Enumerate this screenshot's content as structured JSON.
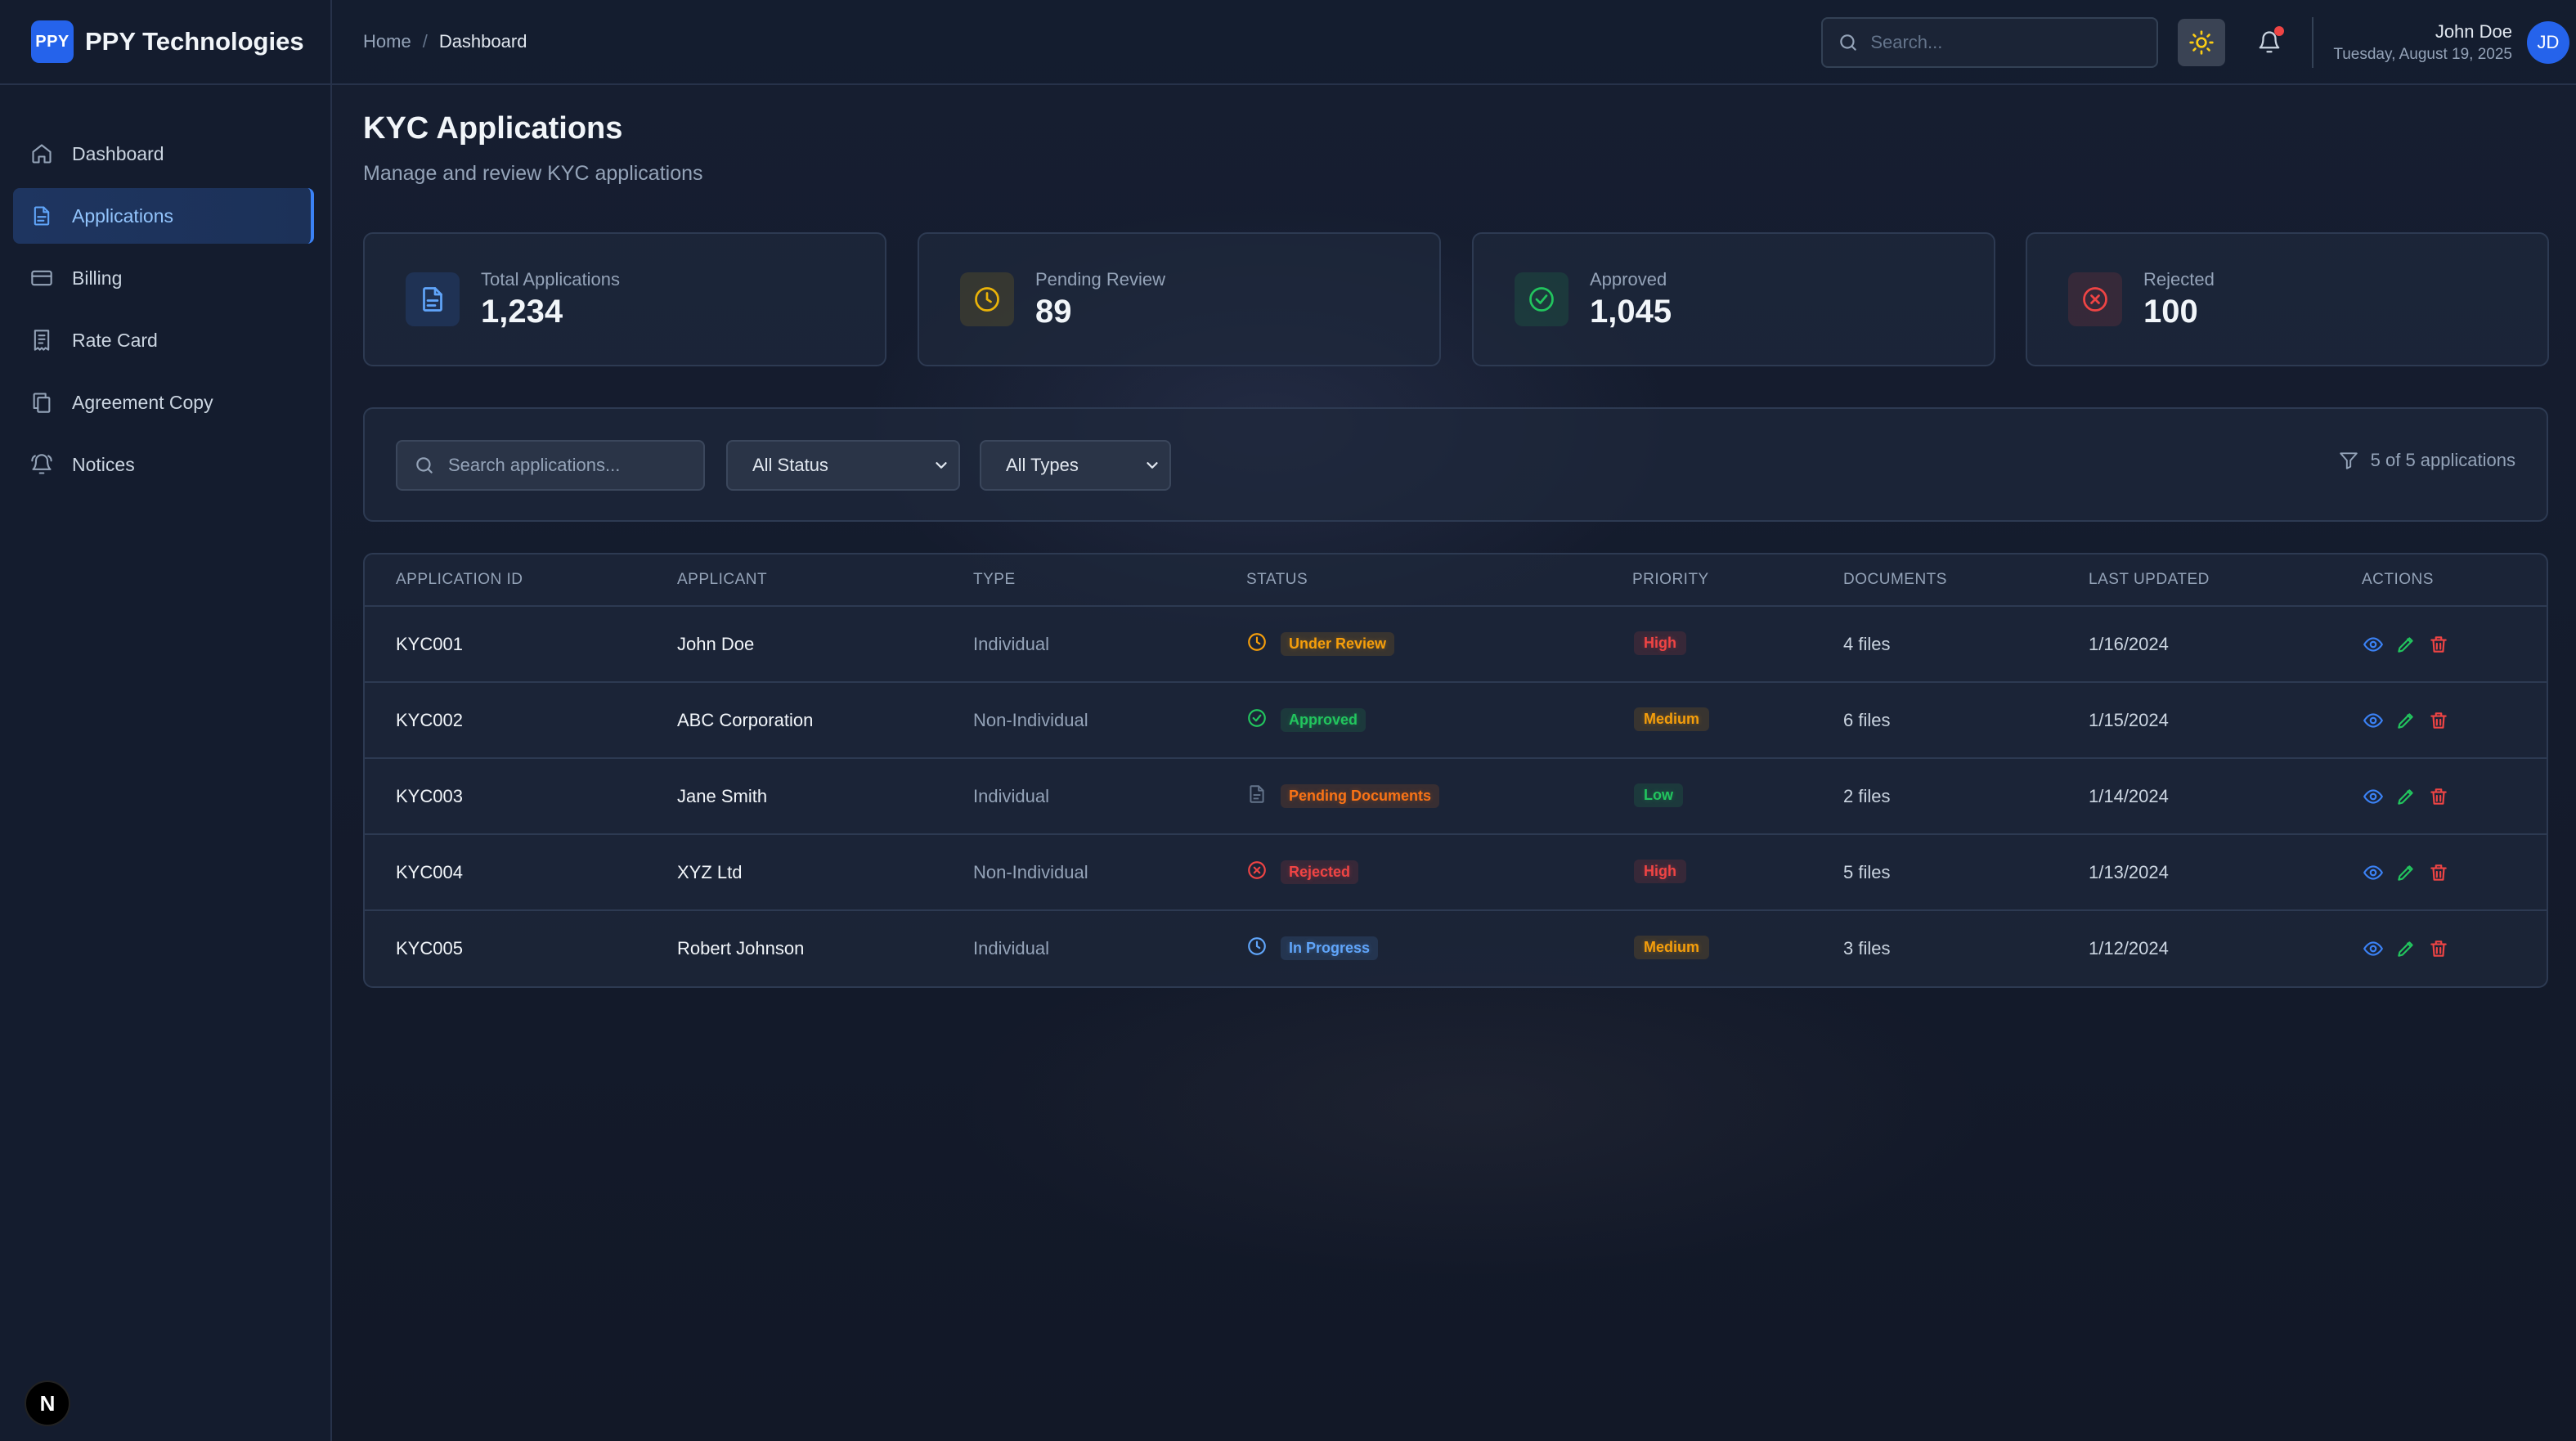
{
  "brand": {
    "logo_text": "PPY",
    "name": "PPY Technologies"
  },
  "sidebar": {
    "items": [
      {
        "label": "Dashboard",
        "icon": "home-icon",
        "active": false
      },
      {
        "label": "Applications",
        "icon": "document-icon",
        "active": true
      },
      {
        "label": "Billing",
        "icon": "credit-card-icon",
        "active": false
      },
      {
        "label": "Rate Card",
        "icon": "receipt-icon",
        "active": false
      },
      {
        "label": "Agreement Copy",
        "icon": "copy-icon",
        "active": false
      },
      {
        "label": "Notices",
        "icon": "bell-ring-icon",
        "active": false
      }
    ],
    "footer_badge": "N"
  },
  "header": {
    "breadcrumb": {
      "home": "Home",
      "separator": "/",
      "current": "Dashboard"
    },
    "search_placeholder": "Search...",
    "user": {
      "name": "John Doe",
      "date": "Tuesday, August 19, 2025",
      "initials": "JD"
    }
  },
  "page": {
    "title": "KYC Applications",
    "subtitle": "Manage and review KYC applications"
  },
  "stats": [
    {
      "label": "Total Applications",
      "value": "1,234",
      "icon": "file-text-icon",
      "color": "#60a5fa"
    },
    {
      "label": "Pending Review",
      "value": "89",
      "icon": "clock-icon",
      "color": "#eab308"
    },
    {
      "label": "Approved",
      "value": "1,045",
      "icon": "check-circle-icon",
      "color": "#22c55e"
    },
    {
      "label": "Rejected",
      "value": "100",
      "icon": "x-circle-icon",
      "color": "#ef4444"
    }
  ],
  "filters": {
    "search_placeholder": "Search applications...",
    "status_selected": "All Status",
    "type_selected": "All Types",
    "count_text": "5 of 5 applications"
  },
  "table": {
    "columns": [
      "APPLICATION ID",
      "APPLICANT",
      "TYPE",
      "STATUS",
      "PRIORITY",
      "DOCUMENTS",
      "LAST UPDATED",
      "ACTIONS"
    ],
    "rows": [
      {
        "id": "KYC001",
        "applicant": "John Doe",
        "type": "Individual",
        "status": "Under Review",
        "status_icon": "clock-icon",
        "priority": "High",
        "documents": "4 files",
        "updated": "1/16/2024"
      },
      {
        "id": "KYC002",
        "applicant": "ABC Corporation",
        "type": "Non-Individual",
        "status": "Approved",
        "status_icon": "check-circle-icon",
        "priority": "Medium",
        "documents": "6 files",
        "updated": "1/15/2024"
      },
      {
        "id": "KYC003",
        "applicant": "Jane Smith",
        "type": "Individual",
        "status": "Pending Documents",
        "status_icon": "file-icon",
        "priority": "Low",
        "documents": "2 files",
        "updated": "1/14/2024"
      },
      {
        "id": "KYC004",
        "applicant": "XYZ Ltd",
        "type": "Non-Individual",
        "status": "Rejected",
        "status_icon": "x-circle-icon",
        "priority": "High",
        "documents": "5 files",
        "updated": "1/13/2024"
      },
      {
        "id": "KYC005",
        "applicant": "Robert Johnson",
        "type": "Individual",
        "status": "In Progress",
        "status_icon": "clock-icon",
        "priority": "Medium",
        "documents": "3 files",
        "updated": "1/12/2024"
      }
    ]
  },
  "colors": {
    "accent": "#3b82f6",
    "status": {
      "Under Review": "#f59e0b",
      "Approved": "#22c55e",
      "Pending Documents": "#f97316",
      "Rejected": "#ef4444",
      "In Progress": "#60a5fa"
    },
    "priority": {
      "High": "#ef4444",
      "Medium": "#f59e0b",
      "Low": "#22c55e"
    }
  }
}
